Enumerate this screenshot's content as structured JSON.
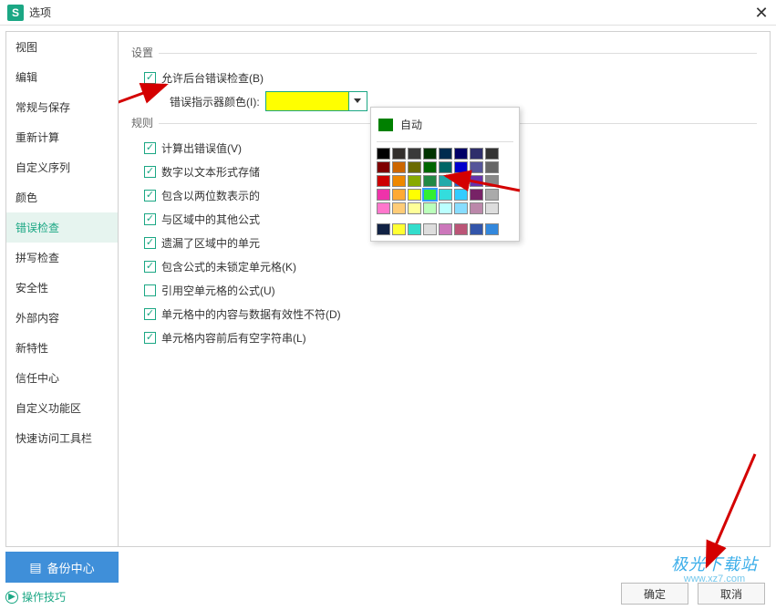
{
  "titlebar": {
    "app_icon": "S",
    "title": "选项"
  },
  "sidebar": {
    "items": [
      {
        "label": "视图"
      },
      {
        "label": "编辑"
      },
      {
        "label": "常规与保存"
      },
      {
        "label": "重新计算"
      },
      {
        "label": "自定义序列"
      },
      {
        "label": "颜色"
      },
      {
        "label": "错误检查",
        "active": true
      },
      {
        "label": "拼写检查"
      },
      {
        "label": "安全性"
      },
      {
        "label": "外部内容"
      },
      {
        "label": "新特性"
      },
      {
        "label": "信任中心"
      },
      {
        "label": "自定义功能区"
      },
      {
        "label": "快速访问工具栏"
      }
    ]
  },
  "settings": {
    "group_label": "设置",
    "allow_bg_check": {
      "label": "允许后台错误检查(B)",
      "checked": true
    },
    "indicator_color_label": "错误指示器颜色(I):",
    "selected_color": "#ffff00"
  },
  "rules": {
    "group_label": "规则",
    "items": [
      {
        "label": "计算出错误值(V)",
        "checked": true
      },
      {
        "label": "数字以文本形式存储",
        "checked": true
      },
      {
        "label": "包含以两位数表示的",
        "checked": true
      },
      {
        "label": "与区域中的其他公式",
        "checked": true
      },
      {
        "label": "遗漏了区域中的单元",
        "checked": true
      },
      {
        "label": "包含公式的未锁定单元格(K)",
        "checked": true
      },
      {
        "label": "引用空单元格的公式(U)",
        "checked": false
      },
      {
        "label": "单元格中的内容与数据有效性不符(D)",
        "checked": true
      },
      {
        "label": "单元格内容前后有空字符串(L)",
        "checked": true
      }
    ]
  },
  "color_picker": {
    "auto_label": "自动",
    "palette1": [
      "#000000",
      "#332f2c",
      "#3a3a3a",
      "#003300",
      "#002c4f",
      "#000066",
      "#2e2e6b",
      "#333333",
      "#7f0000",
      "#cc6600",
      "#6b6b00",
      "#006600",
      "#006666",
      "#0000cc",
      "#555599",
      "#666666",
      "#cc0000",
      "#ee8800",
      "#88aa00",
      "#228844",
      "#22aaaa",
      "#2266cc",
      "#6633aa",
      "#888888",
      "#ee33aa",
      "#ffaa33",
      "#ffff00",
      "#33ee33",
      "#33dddd",
      "#33ccff",
      "#772266",
      "#aaaaaa",
      "#ff77cc",
      "#ffcc77",
      "#ffff99",
      "#bbffbb",
      "#bbffff",
      "#88ddff",
      "#bb88aa",
      "#dddddd"
    ],
    "highlight_index": 27,
    "palette2": [
      "#112244",
      "#ffff33",
      "#33ddcc",
      "#dddddd",
      "#cc77bb",
      "#bb5577",
      "#3355aa",
      "#3388dd"
    ]
  },
  "backup_button": "备份中心",
  "tips_link": "操作技巧",
  "ok_button": "确定",
  "cancel_button": "取消",
  "watermark": {
    "line1": "极光下载站",
    "line2": "www.xz7.com"
  }
}
